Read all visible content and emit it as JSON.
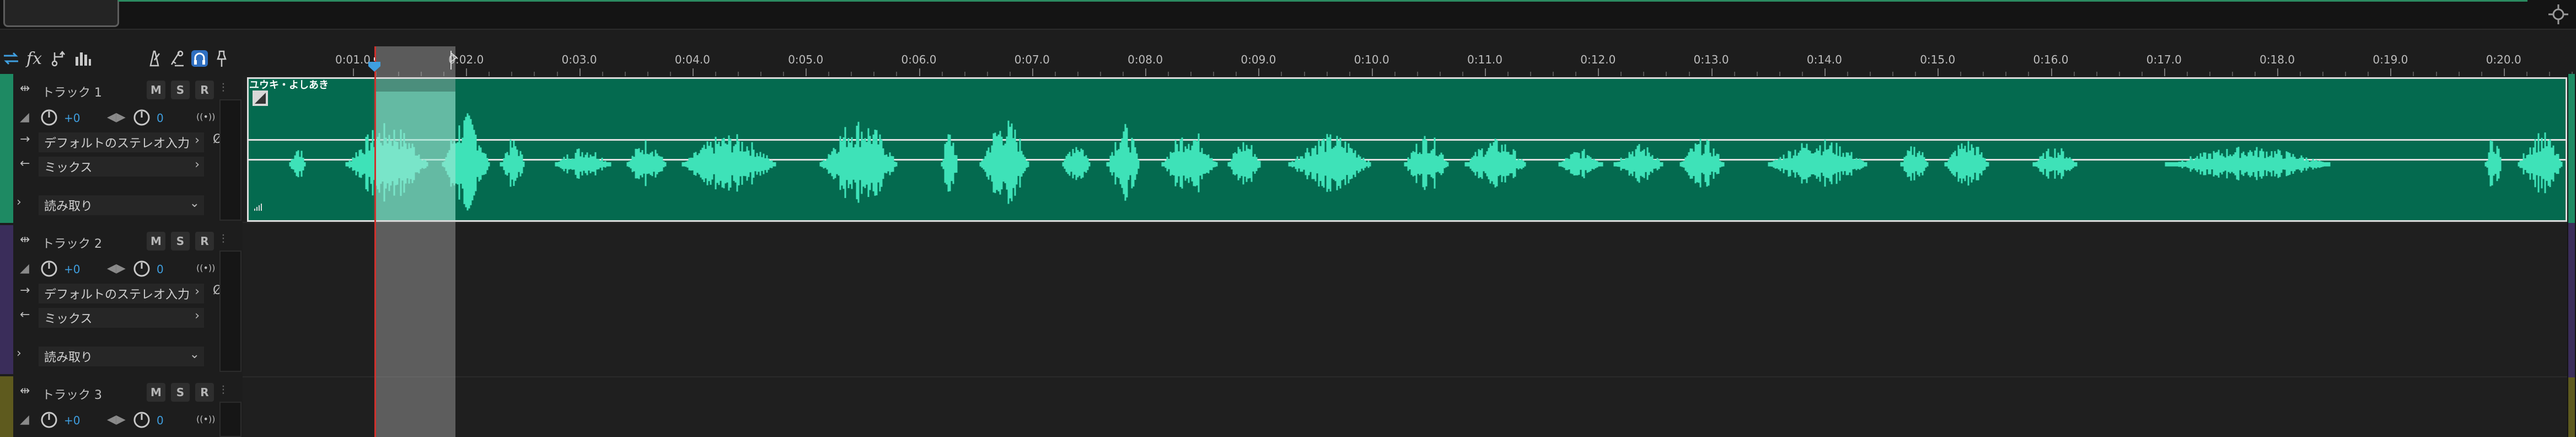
{
  "overview": {
    "fit_icon": "zoom-fit-icon"
  },
  "toolbar": {
    "tools": [
      "loop-toggle-icon",
      "fx-icon",
      "routing-icon",
      "frequency-icon"
    ],
    "fx_label": "fx",
    "right_tools": [
      "metronome-icon",
      "mic-icon",
      "headphones-icon",
      "pin-icon"
    ]
  },
  "ruler": {
    "format_label": "hms",
    "ticks": [
      "0:01.0",
      "0:02.0",
      "0:03.0",
      "0:04.0",
      "0:05.0",
      "0:06.0",
      "0:07.0",
      "0:08.0",
      "0:09.0",
      "0:10.0",
      "0:11.0",
      "0:12.0",
      "0:13.0",
      "0:14.0",
      "0:15.0",
      "0:16.0",
      "0:17.0",
      "0:18.0",
      "0:19.0",
      "0:20.0"
    ]
  },
  "tracks": [
    {
      "name": "トラック 1",
      "color": "#1e8a63",
      "mute": "M",
      "solo": "S",
      "record": "R",
      "volume": "+0",
      "pan": "0",
      "input": "デフォルトのステレオ入力",
      "output": "ミックス",
      "automation": "読み取り"
    },
    {
      "name": "トラック 2",
      "color": "#3a2d5a",
      "mute": "M",
      "solo": "S",
      "record": "R",
      "volume": "+0",
      "pan": "0",
      "input": "デフォルトのステレオ入力",
      "output": "ミックス",
      "automation": "読み取り"
    },
    {
      "name": "トラック 3",
      "color": "#5e5a1e",
      "mute": "M",
      "solo": "S",
      "record": "R",
      "volume": "+0",
      "pan": "0"
    }
  ],
  "clip": {
    "title": "ユウキ・よしあき",
    "color": "#046a4f",
    "wave_color": "#3ee2b8"
  },
  "colors": {
    "playhead": "#d0302c",
    "accent": "#3f9fe0"
  }
}
